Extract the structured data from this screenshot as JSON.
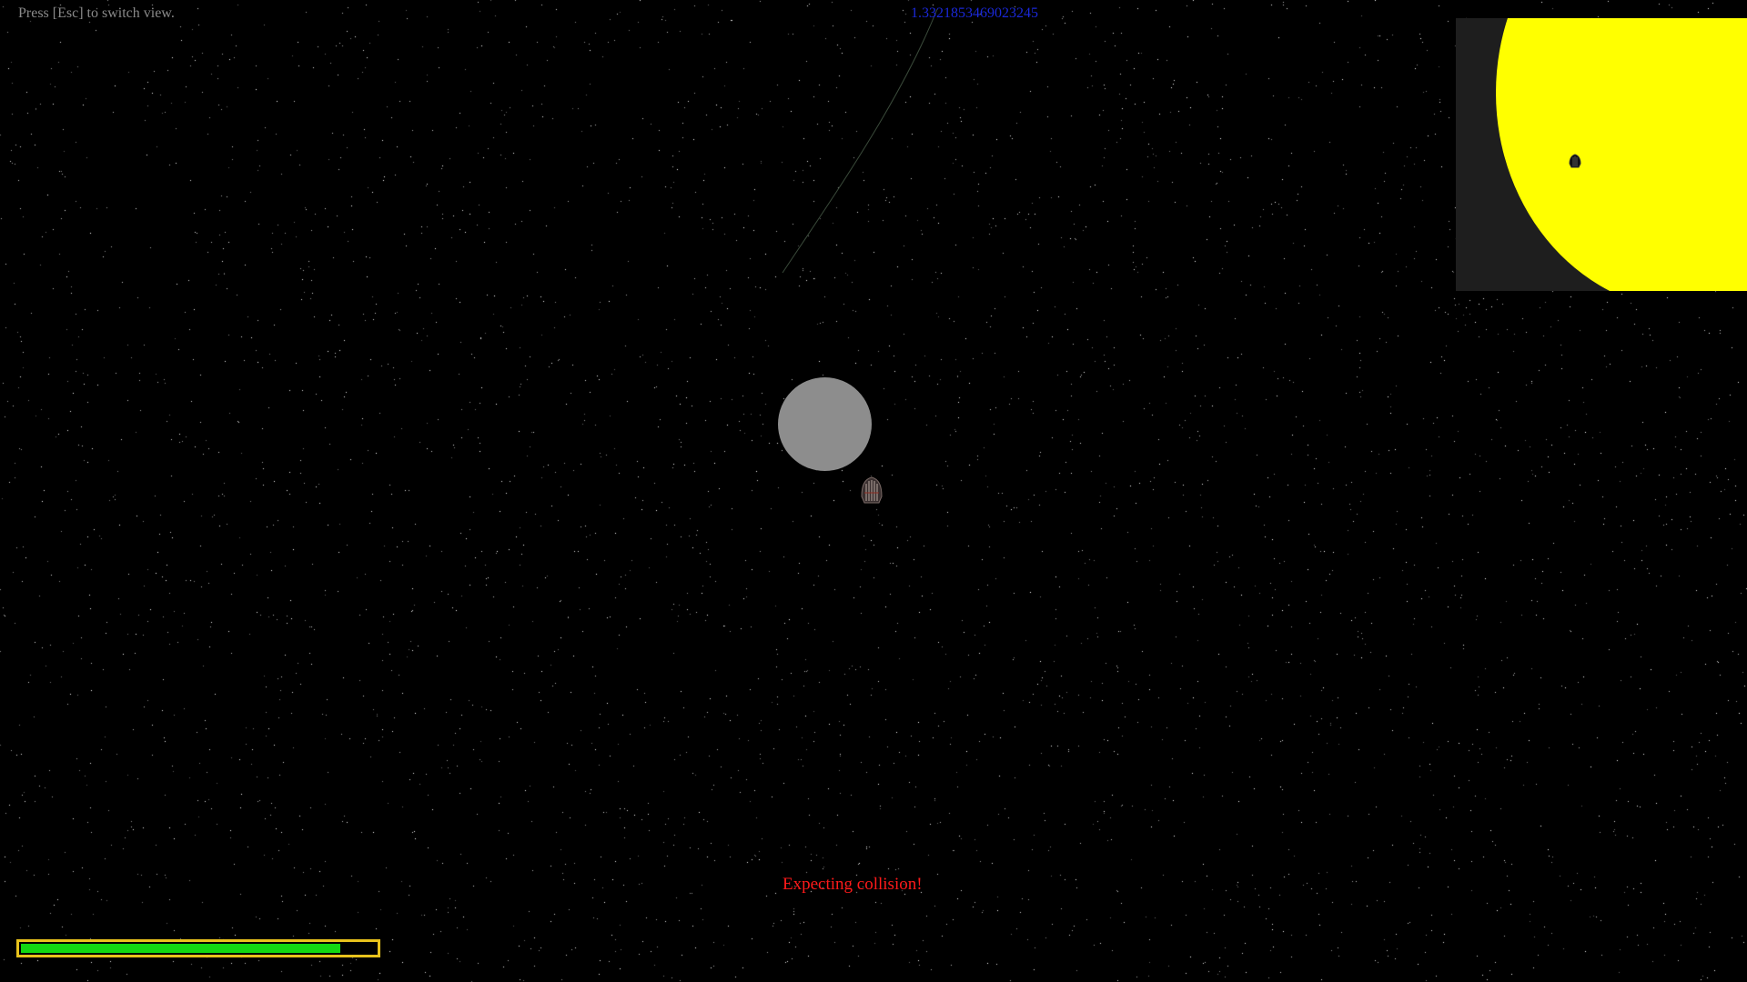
{
  "hud": {
    "hint": "Press [Esc] to switch view.",
    "readout": "1.3321853469023245",
    "warning": "Expecting collision!"
  },
  "fuel": {
    "level": 0.9
  },
  "colors": {
    "hint_text": "#8a8a8a",
    "readout_text": "#1a28d8",
    "warning_text": "#ff1a1a",
    "planet": "#8d8d8d",
    "sun": "#ffff00",
    "minimap_bg": "#1e1e1e",
    "fuel_fill": "#12d812",
    "fuel_border": "#e8c21c"
  },
  "icons": {
    "ship": "spaceship-icon",
    "minimap_ship": "spaceship-icon"
  }
}
